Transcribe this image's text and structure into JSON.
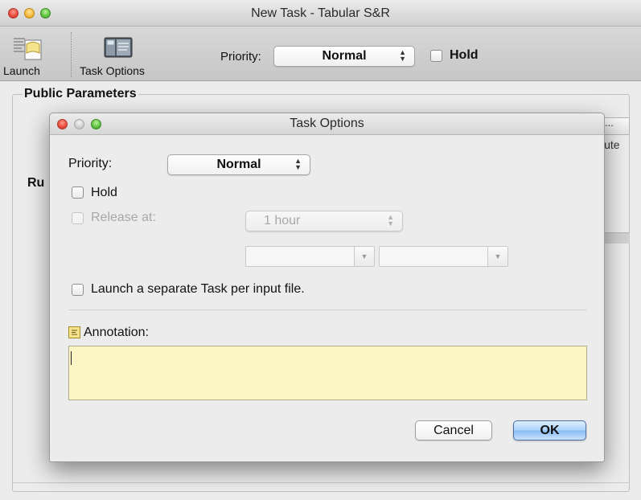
{
  "main_window": {
    "title": "New Task - Tabular S&R",
    "toolbar": {
      "launch_label": "Launch",
      "task_options_label": "Task Options",
      "priority_label": "Priority:",
      "priority_value": "Normal",
      "hold_label": "Hold"
    },
    "public_parameters_label": "Public Parameters",
    "background": {
      "run_label_fragment": "Ru",
      "table_header_fragment": "...",
      "table_text_fragment": "lute"
    }
  },
  "dialog": {
    "title": "Task Options",
    "priority_label": "Priority:",
    "priority_value": "Normal",
    "hold_label": "Hold",
    "release_at_label": "Release at:",
    "release_at_value": "1 hour",
    "separate_task_label": "Launch a separate Task per input file.",
    "annotation_label": "Annotation:",
    "annotation_value": "",
    "cancel_label": "Cancel",
    "ok_label": "OK"
  },
  "icons": {
    "launch": "launch-icon",
    "task_options": "task-options-icon",
    "annotation": "note-icon",
    "dropdown_caret": "up-down-chevron-icon"
  },
  "colors": {
    "annotation_background": "#fcf6c4",
    "default_button": "#89bcf2",
    "close_button": "#e5493a",
    "minimize_button": "#f5b73a",
    "zoom_button": "#5cc13d"
  }
}
